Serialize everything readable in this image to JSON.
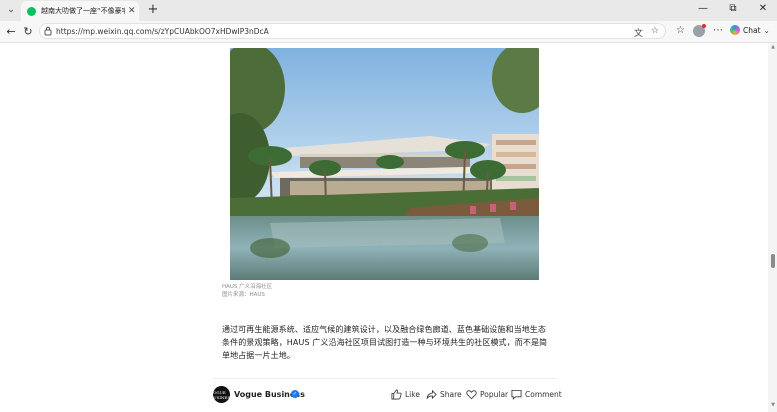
{
  "browser": {
    "tab": {
      "title": "越南大叻做了一座“不像豪宅”的海"
    },
    "url": "https://mp.weixin.qq.com/s/zYpCUAbkOO7xHDwIP3nDcA",
    "chat_label": "Chat"
  },
  "article": {
    "photo_alt": "HAUS 广义沿海社区",
    "caption": {
      "line1": "HAUS 广义沿海社区",
      "line2": "图片来源：HAUS"
    },
    "paragraph": "通过可再生能源系统、适应气候的建筑设计，以及融合绿色廊道、蓝色基础设施和当地生态条件的景观策略，HAUS 广义沿海社区项目试图打造一种与环境共生的社区模式，而不是简单地占据一片土地。",
    "footer": {
      "avatar_text": "VOGUE BUSINESS",
      "account_name": "Vogue Business",
      "like": "Like",
      "share": "Share",
      "popular": "Popular",
      "comment": "Comment"
    }
  },
  "colors": {
    "wechat_green": "#07c160",
    "verified_blue": "#1e7bf3"
  }
}
